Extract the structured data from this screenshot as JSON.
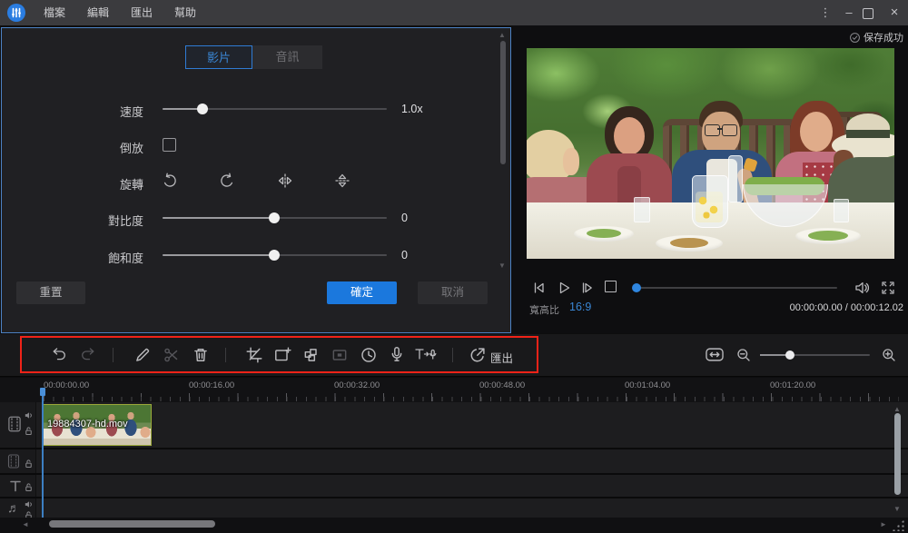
{
  "titlebar": {
    "menus": [
      "檔案",
      "編輯",
      "匯出",
      "幫助"
    ]
  },
  "glyphs": {
    "kebab": "⋮",
    "minimize": "–",
    "close": "×",
    "up": "▲",
    "down": "▼",
    "left": "◄",
    "right": "►",
    "music_note": "♬"
  },
  "panel": {
    "tab_video": "影片",
    "tab_audio": "音訊",
    "speed_label": "速度",
    "speed_value": "1.0x",
    "reverse_label": "倒放",
    "rotate_label": "旋轉",
    "contrast_label": "對比度",
    "contrast_value": "0",
    "saturation_label": "飽和度",
    "saturation_value": "0",
    "reset": "重置",
    "ok": "確定",
    "cancel": "取消"
  },
  "preview": {
    "save_status": "保存成功",
    "aspect_label": "寬高比",
    "aspect_value": "16:9",
    "timecode": "00:00:00.00 / 00:00:12.02"
  },
  "toolbar": {
    "export_label": "匯出"
  },
  "timeline": {
    "ruler_labels": [
      "00:00:00.00",
      "00:00:16.00",
      "00:00:32.00",
      "00:00:48.00",
      "00:01:04.00",
      "00:01:20.00"
    ],
    "clip_filename": "19884307-hd.mov"
  },
  "colors": {
    "accent_blue": "#2f7bd4",
    "ok_button": "#1b78dd",
    "annotation_red": "#ef2318",
    "panel_border": "#4d82c4",
    "clip_border": "#9aa83a"
  }
}
